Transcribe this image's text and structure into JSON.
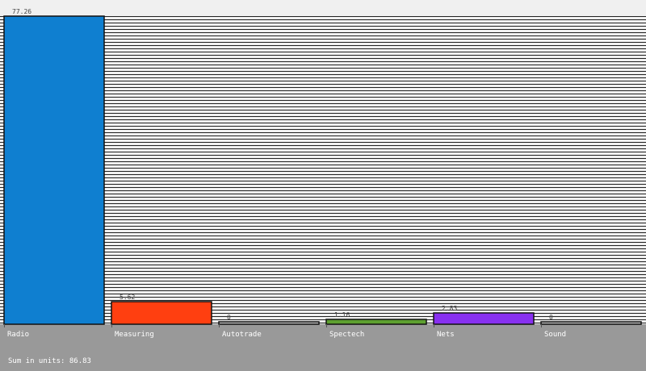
{
  "chart_data": {
    "type": "bar",
    "categories": [
      "Radio",
      "Measuring",
      "Autotrade",
      "Spectech",
      "Nets",
      "Sound"
    ],
    "values": [
      77.26,
      5.62,
      0.0,
      1.16,
      2.83,
      0.0
    ],
    "value_labels": [
      "77.26",
      "5.62",
      "0",
      "1.16",
      "2.83",
      "0"
    ],
    "colors": [
      "#0f7fd0",
      "#ff3f10",
      "#bfbfbf",
      "#5ea030",
      "#8830f0",
      "#bfbfbf"
    ],
    "ylim": [
      0,
      77.26
    ],
    "grid": true,
    "title": "",
    "xlabel": "",
    "ylabel": ""
  },
  "footer": {
    "sum_text": "Sum in units: 86.83"
  },
  "colors": {
    "background": "#999999",
    "plot_background": "#f0f0f0",
    "grid": "#222222"
  }
}
